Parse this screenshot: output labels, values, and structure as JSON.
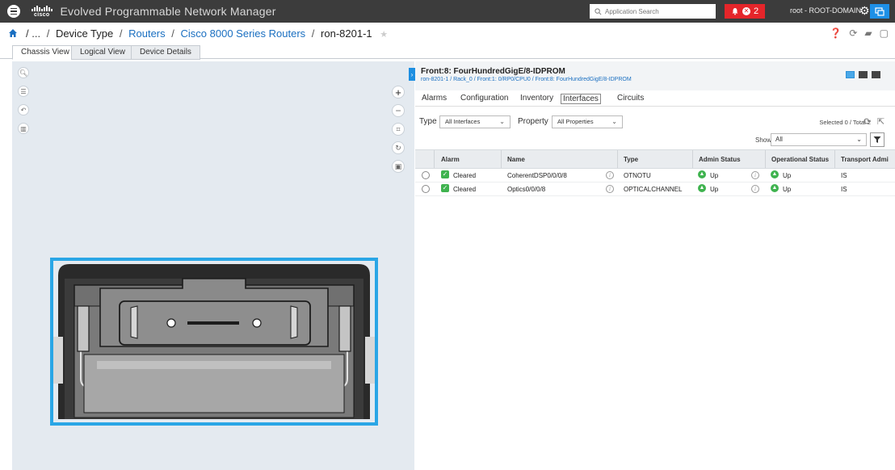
{
  "header": {
    "brand": "cisco",
    "title": "Evolved Programmable Network Manager",
    "search_placeholder": "Application Search",
    "alarm_count": "2",
    "user": "root - ROOT-DOMAIN"
  },
  "breadcrumb": {
    "root": "/ ...",
    "device_type": "Device Type",
    "routers": "Routers",
    "series": "Cisco 8000 Series Routers",
    "device": "ron-8201-1"
  },
  "tabs": [
    "Chassis View",
    "Logical View",
    "Device Details"
  ],
  "details": {
    "title": "Front:8: FourHundredGigE/8-IDPROM",
    "path": "ron-8201-1 / Rack_0 / Front:1: 0/RP0/CPU0 / Front:8: FourHundredGigE/8-IDPROM",
    "subtabs": [
      "Alarms",
      "Configuration",
      "Inventory",
      "Interfaces",
      "Circuits"
    ],
    "active_subtab": "Interfaces",
    "filters": {
      "type_label": "Type",
      "type_value": "All Interfaces",
      "property_label": "Property",
      "property_value": "All Properties",
      "selection": "Selected 0 / Total 2",
      "show_label": "Show",
      "show_value": "All"
    },
    "columns": [
      "Alarm",
      "Name",
      "Type",
      "Admin Status",
      "Operational Status",
      "Transport Admi"
    ],
    "rows": [
      {
        "alarm": "Cleared",
        "name": "CoherentDSP0/0/0/8",
        "type": "OTNOTU",
        "admin": "Up",
        "oper": "Up",
        "transport": "IS"
      },
      {
        "alarm": "Cleared",
        "name": "Optics0/0/0/8",
        "type": "OPTICALCHANNEL",
        "admin": "Up",
        "oper": "Up",
        "transport": "IS"
      }
    ]
  },
  "colors": {
    "header_bg": "#3c3c3c",
    "accent": "#1e8fe1",
    "alarm": "#e5252a",
    "status_ok": "#3fb34f",
    "chassis_bg": "#e4eaf0"
  }
}
